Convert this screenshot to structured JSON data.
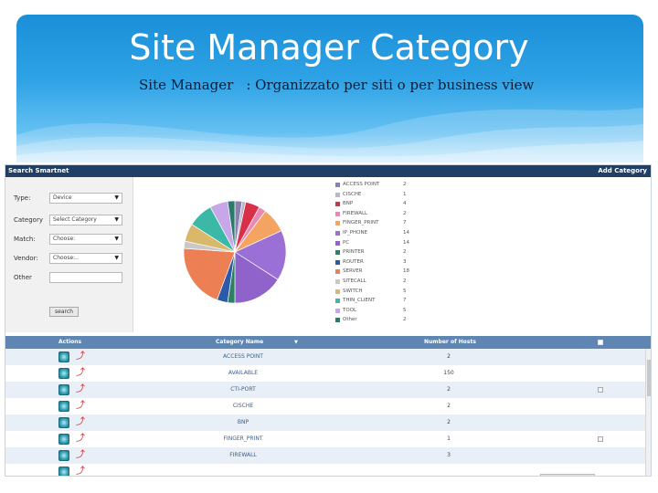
{
  "header": {
    "title": "Site Manager Category",
    "subtitle_left": "Site Manager",
    "subtitle_right": ": Organizzato per siti o per business view"
  },
  "toolbar": {
    "left": "Search Smartnet",
    "right": "Add Category"
  },
  "search": {
    "type_label": "Type:",
    "type_value": "Device",
    "category_label": "Category",
    "category_value": "Select Category",
    "match_label": "Match:",
    "match_value": "Choose:",
    "vendor_label": "Vendor:",
    "vendor_value": "Choose:..",
    "other_label": "Other",
    "search_button": "search"
  },
  "chart_data": {
    "type": "pie",
    "categories": [
      "ACCESS POINT",
      "CISCHE",
      "BNP",
      "FIREWALL",
      "FINGER_PRINT",
      "IP_PHONE",
      "PC",
      "PRINTER",
      "ROUTER",
      "SERVER",
      "SITECALL",
      "SWITCH",
      "THIN_CLIENT",
      "TOOL",
      "Other"
    ],
    "values": [
      2,
      1,
      4,
      2,
      7,
      14,
      14,
      2,
      3,
      18,
      2,
      5,
      7,
      5,
      2
    ],
    "colors": [
      "#8a7fb0",
      "#b8b8c8",
      "#d9304a",
      "#e889b5",
      "#f4a460",
      "#9a6fd6",
      "#8f63c9",
      "#2f7f63",
      "#2b5aa8",
      "#ed7f55",
      "#c9c9c9",
      "#d9b86b",
      "#3cb8a7",
      "#c8a7e8",
      "#2c7a6a"
    ]
  },
  "table": {
    "headers": {
      "actions": "Actions",
      "category": "Category Name",
      "sort": "▼",
      "hosts": "Number of Hosts"
    },
    "rows": [
      {
        "name": "ACCESS POINT",
        "hosts": "2",
        "check": false
      },
      {
        "name": "AVAILABLE",
        "hosts": "150",
        "check": false
      },
      {
        "name": "CTI-PORT",
        "hosts": "2",
        "check": true
      },
      {
        "name": "CISCHE",
        "hosts": "2",
        "check": false
      },
      {
        "name": "BNP",
        "hosts": "2",
        "check": false
      },
      {
        "name": "FINGER_PRINT",
        "hosts": "1",
        "check": true
      },
      {
        "name": "FIREWALL",
        "hosts": "3",
        "check": false
      },
      {
        "name": "",
        "hosts": "",
        "check": false
      }
    ]
  },
  "icons": {
    "action_icon": "settings-icon",
    "pdf_icon": "pdf-icon"
  }
}
